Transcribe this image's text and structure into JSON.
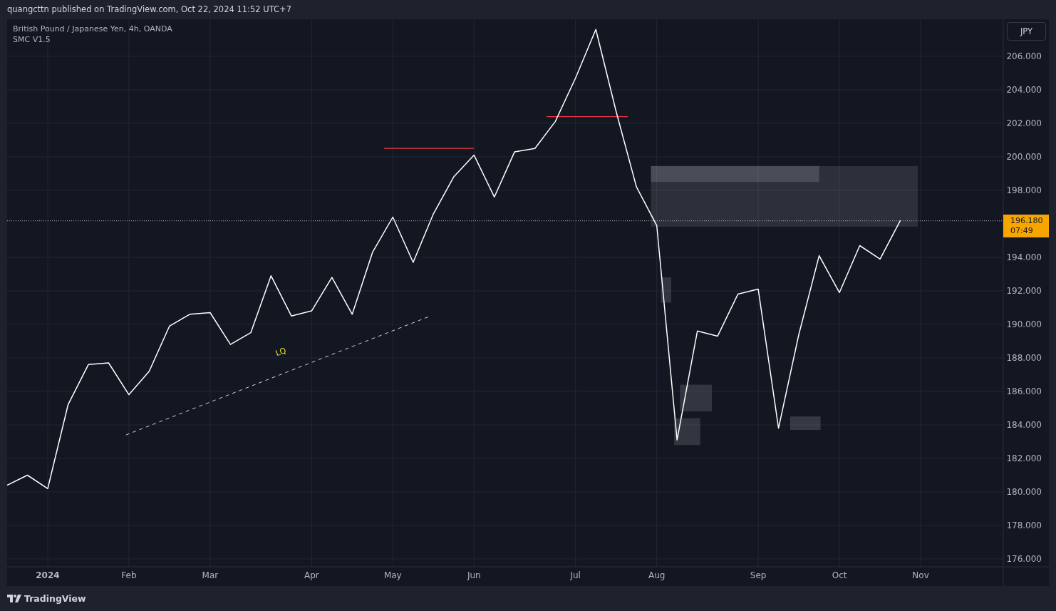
{
  "header": {
    "text": "quangcttn published on TradingView.com, Oct 22, 2024 11:52 UTC+7"
  },
  "chart": {
    "legend": {
      "symbol": "British Pound / Japanese Yen, 4h, OANDA",
      "indicator": "SMC V1.5"
    },
    "currency_button": "JPY",
    "last_price": {
      "value": "196.180",
      "countdown": "07:49"
    },
    "chart_data": {
      "type": "line",
      "categories": [
        null,
        null,
        "2024",
        null,
        null,
        null,
        "Feb",
        null,
        null,
        null,
        "Mar",
        null,
        null,
        null,
        null,
        "Apr",
        null,
        null,
        null,
        "May",
        null,
        null,
        null,
        "Jun",
        null,
        null,
        null,
        null,
        "Jul",
        null,
        null,
        null,
        "Aug",
        null,
        null,
        null,
        null,
        "Sep",
        null,
        null,
        null,
        "Oct",
        null,
        null,
        null,
        "Nov",
        null,
        null,
        null,
        null
      ],
      "series": [
        {
          "color": "#ffffff",
          "values": [
            180.4,
            181.0,
            180.2,
            185.2,
            187.6,
            187.7,
            185.8,
            187.2,
            189.9,
            190.6,
            190.7,
            188.8,
            189.5,
            192.9,
            190.5,
            190.8,
            192.8,
            190.6,
            194.3,
            196.4,
            193.7,
            196.6,
            198.8,
            200.1,
            197.6,
            200.3,
            200.5,
            202.1,
            204.7,
            207.6,
            202.7,
            198.2,
            195.9,
            183.1,
            189.6,
            189.3,
            191.8,
            192.1,
            183.8,
            189.4,
            194.1,
            191.9,
            194.7,
            193.9,
            196.2,
            null,
            null,
            null,
            null,
            null
          ]
        }
      ],
      "ylim": [
        175.53,
        208.21
      ],
      "yticks": [
        {
          "value": 206,
          "label": "206.000"
        },
        {
          "value": 204,
          "label": "204.000"
        },
        {
          "value": 202,
          "label": "202.000"
        },
        {
          "value": 200,
          "label": "200.000"
        },
        {
          "value": 198,
          "label": "198.000"
        },
        {
          "value": 194,
          "label": "194.000"
        },
        {
          "value": 192,
          "label": "192.000"
        },
        {
          "value": 190,
          "label": "190.000"
        },
        {
          "value": 188,
          "label": "188.000"
        },
        {
          "value": 186,
          "label": "186.000"
        },
        {
          "value": 184,
          "label": "184.000"
        },
        {
          "value": 182,
          "label": "182.000"
        },
        {
          "value": 180,
          "label": "180.000"
        },
        {
          "value": 178,
          "label": "178.000"
        },
        {
          "value": 176,
          "label": "176.000"
        }
      ],
      "grid": true,
      "ref_lines": [
        {
          "axis": "y",
          "value": 196.18
        }
      ],
      "annotations": [
        "LQ"
      ]
    }
  },
  "footer": {
    "brand": "TradingView"
  }
}
